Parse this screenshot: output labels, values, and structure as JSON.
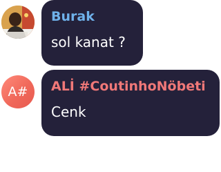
{
  "messages": [
    {
      "sender": "Burak",
      "text": "sol kanat ?",
      "avatar": {
        "type": "photo",
        "color": "#6fb1ea"
      }
    },
    {
      "sender": "ALİ #CoutinhoNöbeti",
      "text": "Cenk",
      "avatar": {
        "type": "initials",
        "initials": "A#",
        "color": "#f07878"
      }
    }
  ],
  "colors": {
    "bubble_background": "#24213a",
    "message_text": "#ffffff",
    "avatar_initials_background": "#f0685a"
  }
}
